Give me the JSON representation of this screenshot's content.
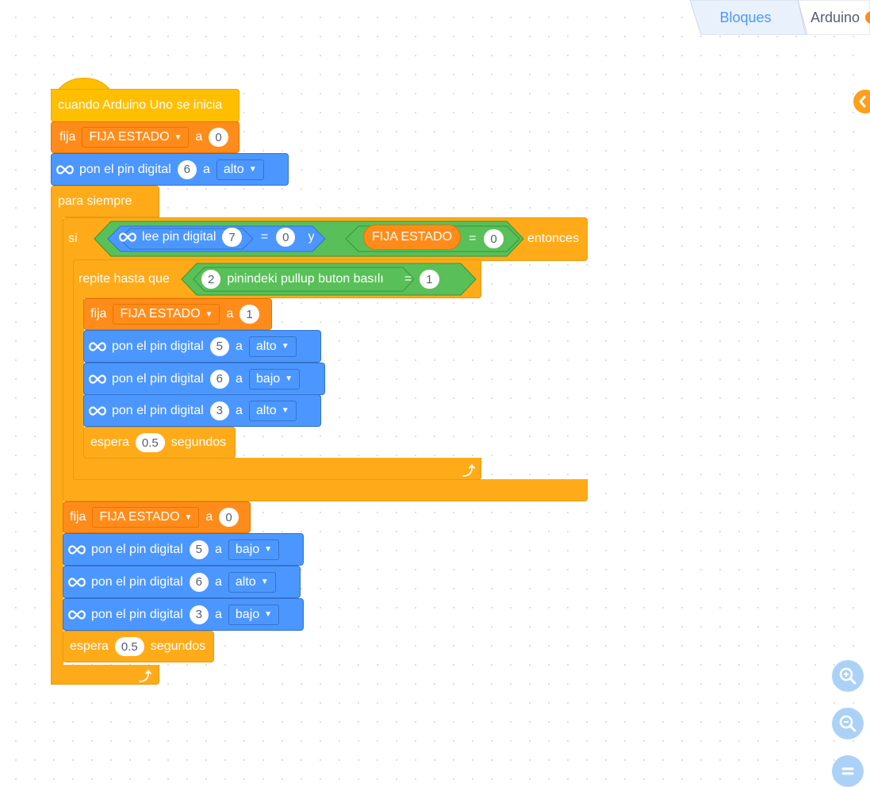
{
  "tabs": [
    {
      "label": "Bloques",
      "active": true
    },
    {
      "label": "Arduino",
      "active": false
    }
  ],
  "colors": {
    "event": "#ffbf00",
    "control": "#ffab19",
    "variable": "#ff8c1a",
    "arduino": "#4c97ff",
    "operator": "#59c059",
    "tab_active_text": "#4c97ff"
  },
  "script": {
    "hat": "cuando Arduino Uno se inicia",
    "set1": {
      "label": "fija",
      "var": "FIJA ESTADO",
      "a": "a",
      "value": "0"
    },
    "pin1": {
      "label": "pon el pin digital",
      "pin": "6",
      "a": "a",
      "state": "alto"
    },
    "forever": "para siempre",
    "if_block": {
      "si": "si",
      "read_label": "lee pin digital",
      "read_pin": "7",
      "eq": "=",
      "read_value": "0",
      "and": "y",
      "var": "FIJA ESTADO",
      "var_value": "0",
      "then": "entonces"
    },
    "repeat": {
      "label": "repite hasta que",
      "pin": "2",
      "sensor": "pinindeki pullup buton basılı",
      "eq": "=",
      "value": "1"
    },
    "inner": {
      "set": {
        "label": "fija",
        "var": "FIJA ESTADO",
        "a": "a",
        "value": "1"
      },
      "pins": [
        {
          "label": "pon el pin digital",
          "pin": "5",
          "a": "a",
          "state": "alto"
        },
        {
          "label": "pon el pin digital",
          "pin": "6",
          "a": "a",
          "state": "bajo"
        },
        {
          "label": "pon el pin digital",
          "pin": "3",
          "a": "a",
          "state": "alto"
        }
      ],
      "wait": {
        "label": "espera",
        "value": "0.5",
        "unit": "segundos"
      }
    },
    "after": {
      "set": {
        "label": "fija",
        "var": "FIJA ESTADO",
        "a": "a",
        "value": "0"
      },
      "pins": [
        {
          "label": "pon el pin digital",
          "pin": "5",
          "a": "a",
          "state": "bajo"
        },
        {
          "label": "pon el pin digital",
          "pin": "6",
          "a": "a",
          "state": "alto"
        },
        {
          "label": "pon el pin digital",
          "pin": "3",
          "a": "a",
          "state": "bajo"
        }
      ],
      "wait": {
        "label": "espera",
        "value": "0.5",
        "unit": "segundos"
      }
    }
  },
  "icons": {
    "infinity": "arduino-infinity-icon",
    "loop_arrow": "loop-arrow-icon",
    "collapse": "collapse-panel-icon",
    "zoom_in": "zoom-in-icon",
    "zoom_out": "zoom-out-icon",
    "zoom_reset": "zoom-reset-icon"
  }
}
